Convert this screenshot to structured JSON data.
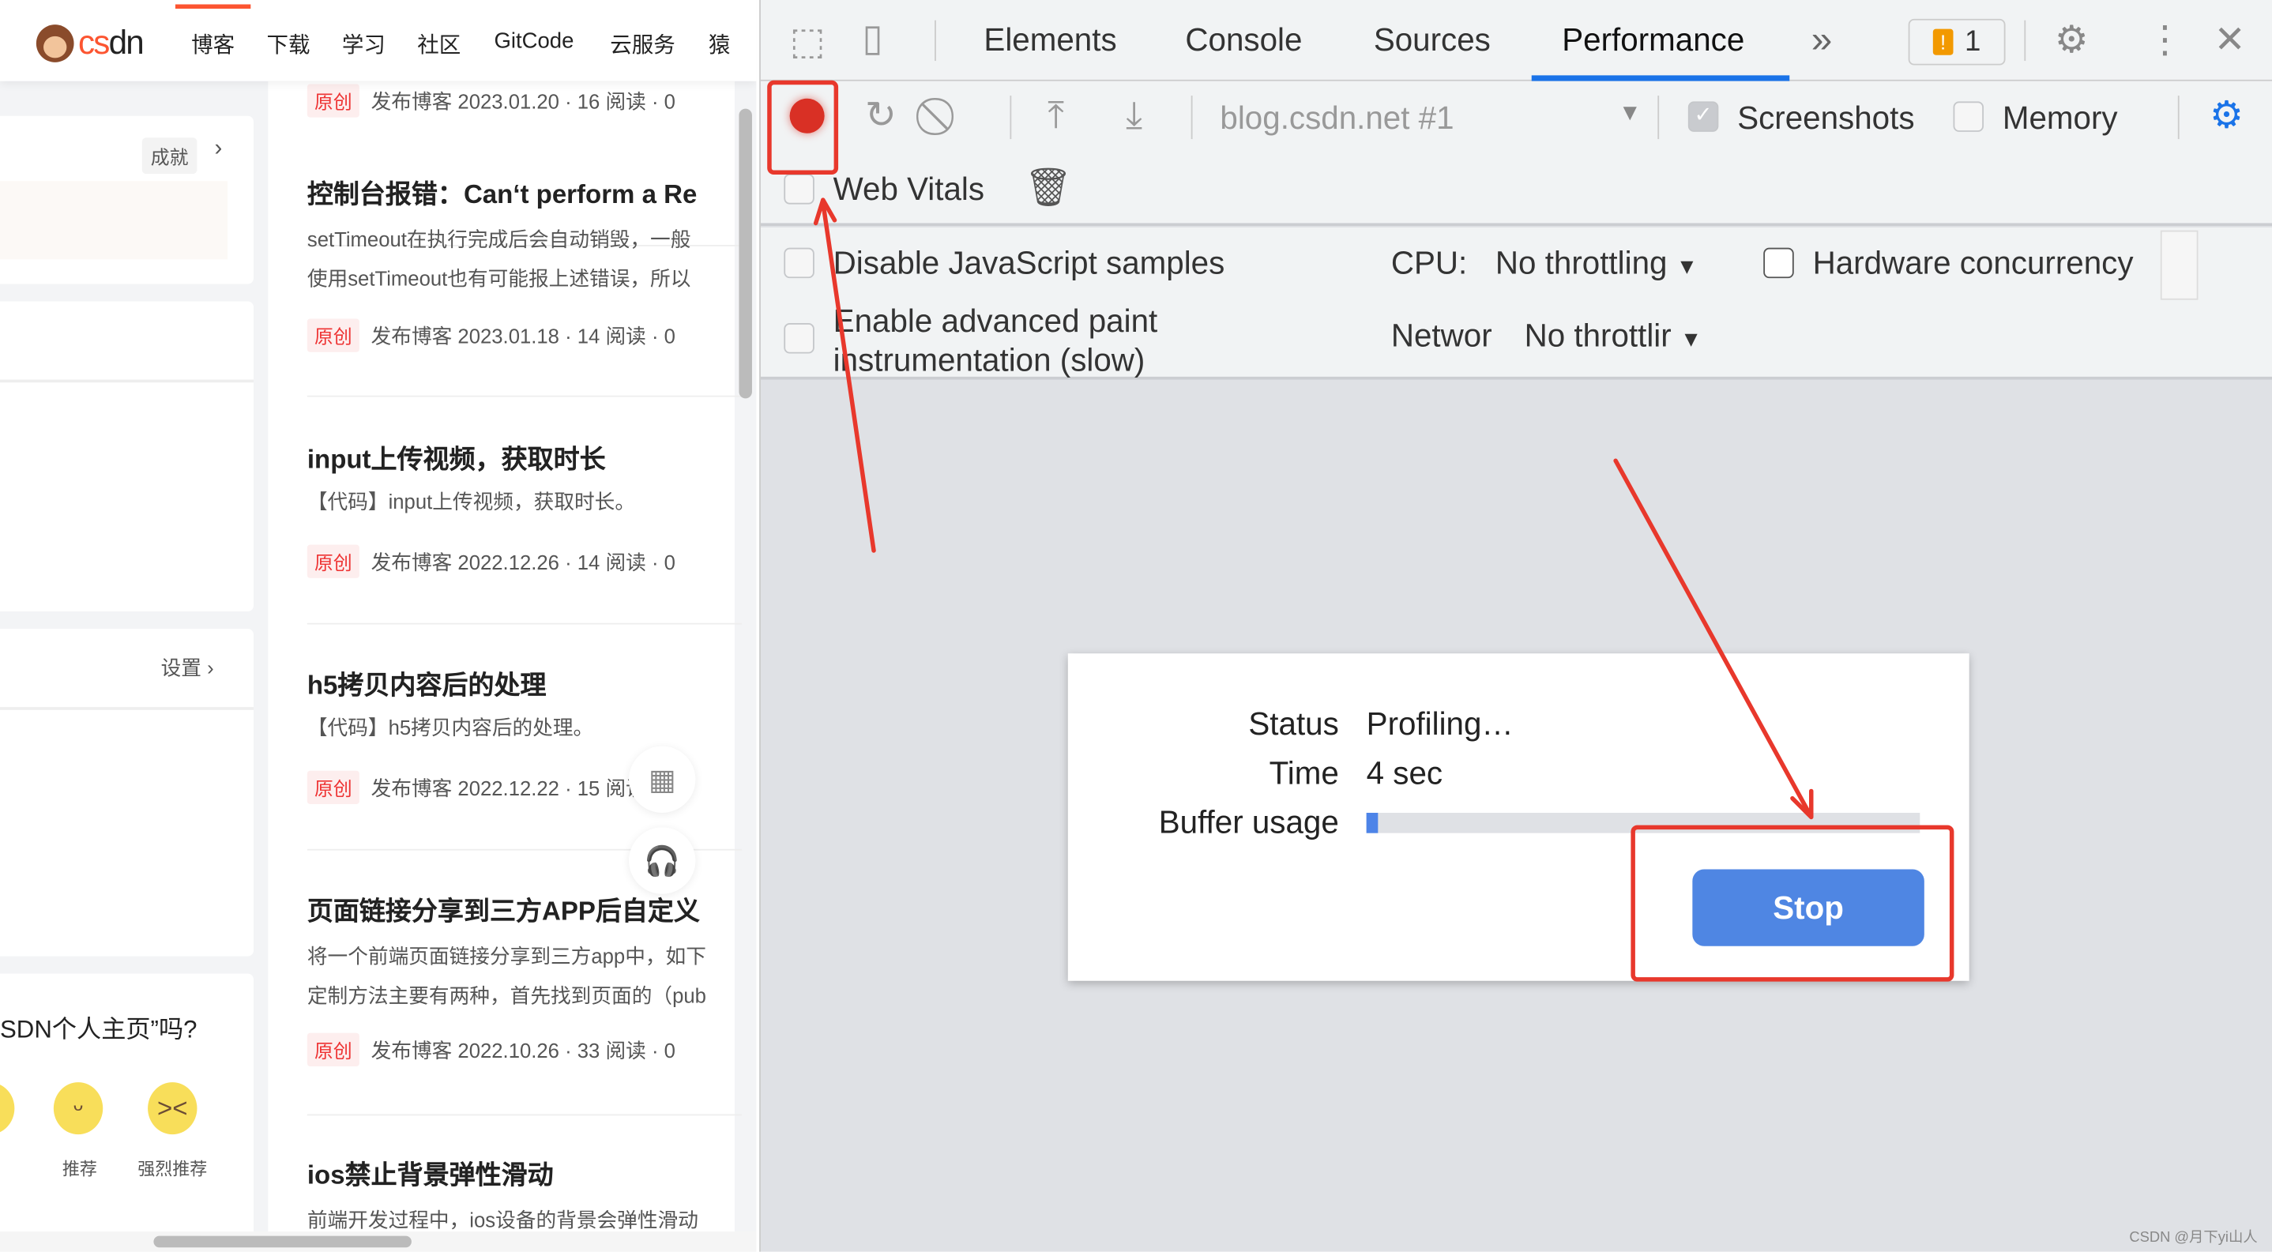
{
  "webpage": {
    "logo_text": "CSDN",
    "nav": [
      "博客",
      "下载",
      "学习",
      "社区",
      "GitCode",
      "云服务",
      "猿"
    ],
    "sidebar": {
      "achievement_label": "成就",
      "settings_link": "设置",
      "survey_question": "SDN个人主页”吗?",
      "ratings": [
        "",
        "推荐",
        "强烈推荐"
      ]
    },
    "posts": [
      {
        "title": "",
        "desc": [],
        "tag": "原创",
        "meta": "发布博客 2023.01.20 · 16 阅读 · 0"
      },
      {
        "title": "控制台报错：Can‘t perform a Re",
        "desc": [
          "setTimeout在执行完成后会自动销毁，一般",
          "使用setTimeout也有可能报上述错误，所以"
        ],
        "tag": "原创",
        "meta": "发布博客 2023.01.18 · 14 阅读 · 0"
      },
      {
        "title": "input上传视频，获取时长",
        "desc": [
          "【代码】input上传视频，获取时长。"
        ],
        "tag": "原创",
        "meta": "发布博客 2022.12.26 · 14 阅读 · 0"
      },
      {
        "title": "h5拷贝内容后的处理",
        "desc": [
          "【代码】h5拷贝内容后的处理。"
        ],
        "tag": "原创",
        "meta": "发布博客 2022.12.22 · 15 阅读 · 0"
      },
      {
        "title": "页面链接分享到三方APP后自定义",
        "desc": [
          "将一个前端页面链接分享到三方app中，如下",
          "定制方法主要有两种，首先找到页面的（pub"
        ],
        "tag": "原创",
        "meta": "发布博客 2022.10.26 · 33 阅读 · 0"
      },
      {
        "title": "ios禁止背景弹性滑动",
        "desc": [
          "前端开发过程中，ios设备的背景会弹性滑动"
        ],
        "tag": "",
        "meta": ""
      }
    ]
  },
  "devtools": {
    "tabs": [
      "Elements",
      "Console",
      "Sources",
      "Performance"
    ],
    "active_tab": "Performance",
    "issues_count": "1",
    "toolbar": {
      "target": "blog.csdn.net #1",
      "screenshots_label": "Screenshots",
      "screenshots_checked": true,
      "memory_label": "Memory",
      "memory_checked": false,
      "web_vitals_label": "Web Vitals",
      "web_vitals_checked": false
    },
    "settings": {
      "disable_js_label": "Disable JavaScript samples",
      "paint_label_1": "Enable advanced paint",
      "paint_label_2": "instrumentation (slow)",
      "cpu_label": "CPU:",
      "cpu_value": "No throttling",
      "network_label": "Networ",
      "network_value": "No throttlir",
      "hw_label": "Hardware concurrency"
    },
    "dialog": {
      "status_label": "Status",
      "status_value": "Profiling…",
      "time_label": "Time",
      "time_value": "4 sec",
      "buffer_label": "Buffer usage",
      "buffer_usage_percent": 2,
      "stop_label": "Stop"
    },
    "colors": {
      "accent": "#1a73e8",
      "record": "#d93025",
      "stop_button": "#4f86e3",
      "annotation": "#e8382c"
    }
  },
  "watermark": "CSDN @月下yi山人"
}
